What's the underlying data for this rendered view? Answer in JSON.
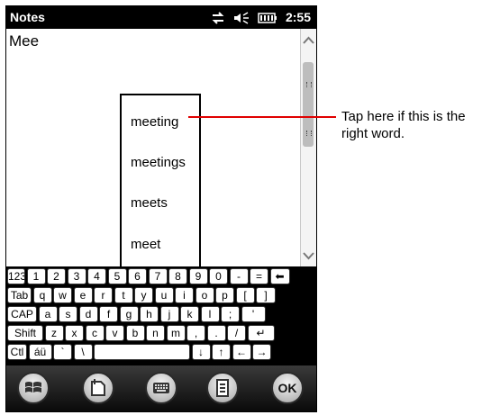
{
  "status_bar": {
    "app_title": "Notes",
    "time": "2:55",
    "icons": [
      "connectivity-icon",
      "speaker-icon",
      "battery-icon"
    ]
  },
  "note": {
    "text": "Mee"
  },
  "suggestions": [
    "meeting",
    "meetings",
    "meets",
    "meet"
  ],
  "keyboard": {
    "rows": [
      [
        "123",
        "1",
        "2",
        "3",
        "4",
        "5",
        "6",
        "7",
        "8",
        "9",
        "0",
        "-",
        "=",
        "⬅"
      ],
      [
        "Tab",
        "q",
        "w",
        "e",
        "r",
        "t",
        "y",
        "u",
        "i",
        "o",
        "p",
        "[",
        "]"
      ],
      [
        "CAP",
        "a",
        "s",
        "d",
        "f",
        "g",
        "h",
        "j",
        "k",
        "l",
        ";",
        "'"
      ],
      [
        "Shift",
        "z",
        "x",
        "c",
        "v",
        "b",
        "n",
        "m",
        ",",
        ".",
        "/",
        "↵"
      ],
      [
        "Ctl",
        "áü",
        "`",
        "\\",
        "",
        "↓",
        "↑",
        "←",
        "→"
      ]
    ]
  },
  "softkeys": {
    "ok_label": "OK",
    "icons": [
      "windows-start-icon",
      "new-note-icon",
      "keyboard-icon",
      "menu-icon"
    ]
  },
  "callout": {
    "text": "Tap here if this is the right word."
  },
  "colors": {
    "callout_line": "#e00000",
    "status_bar_bg": "#000000"
  }
}
